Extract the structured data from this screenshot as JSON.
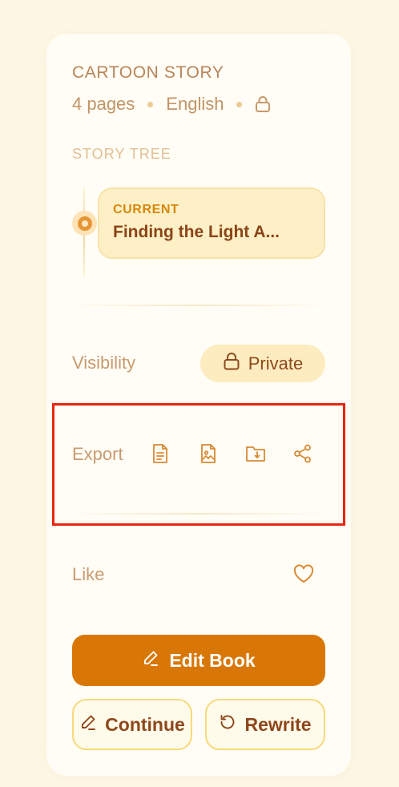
{
  "header": {
    "type_title": "CARTOON STORY",
    "pages": "4 pages",
    "language": "English",
    "lock_icon": "lock-icon"
  },
  "story_tree": {
    "label": "STORY TREE",
    "current_tag": "CURRENT",
    "current_title": "Finding the Light A..."
  },
  "visibility": {
    "label": "Visibility",
    "value": "Private",
    "icon": "lock-icon"
  },
  "export": {
    "label": "Export",
    "icons": [
      "document-icon",
      "image-file-icon",
      "download-folder-icon",
      "share-icon"
    ]
  },
  "like": {
    "label": "Like",
    "icon": "heart-icon"
  },
  "actions": {
    "edit": "Edit Book",
    "continue": "Continue",
    "rewrite": "Rewrite"
  },
  "colors": {
    "accent": "#d97706",
    "highlight": "#e8260f",
    "background": "#fdf7e6",
    "card": "#fffdf5"
  }
}
